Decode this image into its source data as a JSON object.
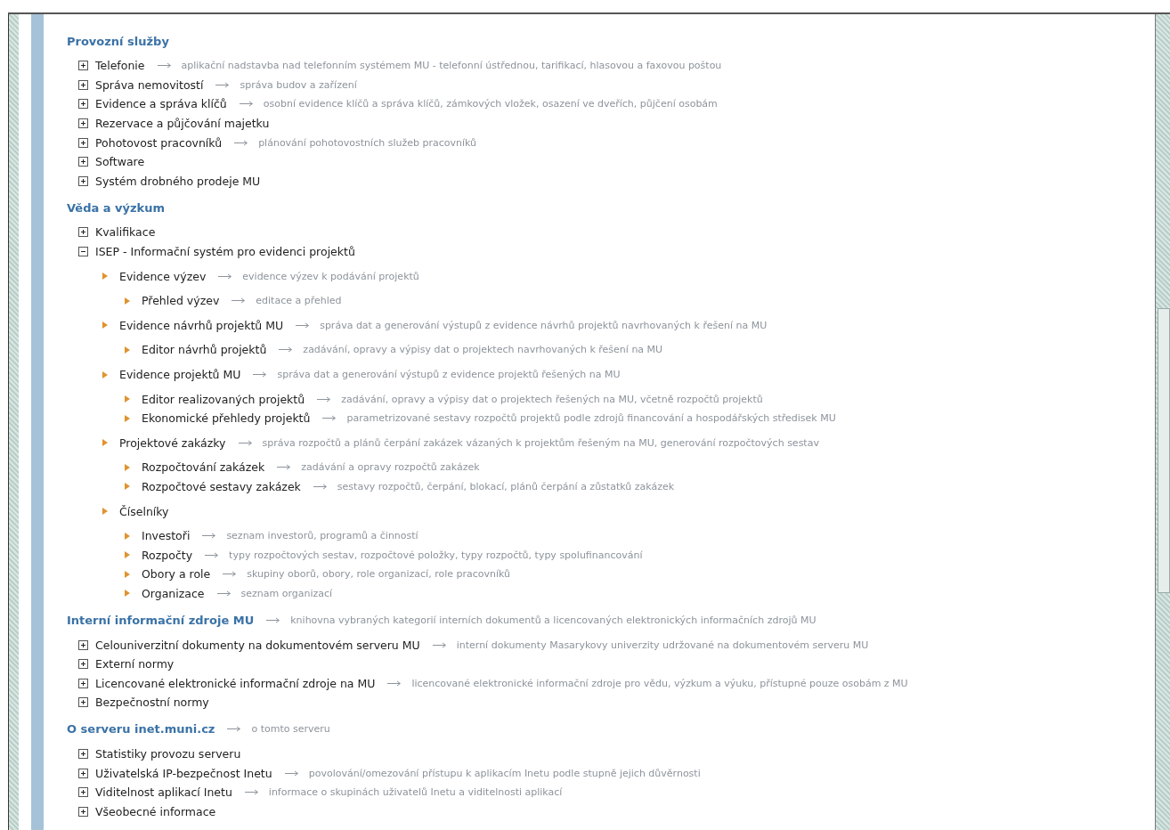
{
  "sections": [
    {
      "title": "Provozní služby",
      "items": [
        {
          "label": "Telefonie",
          "description": "aplikační nadstavba nad telefonním systémem MU - telefonní ústřednou, tarifikací, hlasovou a faxovou poštou",
          "expanded": false
        },
        {
          "label": "Správa nemovitostí",
          "description": "správa budov a zařízení",
          "expanded": false
        },
        {
          "label": "Evidence a správa klíčů",
          "description": "osobní evidence klíčů a správa klíčů, zámkových vložek, osazení ve dveřích, půjčení osobám",
          "expanded": false
        },
        {
          "label": "Rezervace a půjčování majetku",
          "expanded": false
        },
        {
          "label": "Pohotovost pracovníků",
          "description": "plánování pohotovostních služeb pracovníků",
          "expanded": false
        },
        {
          "label": "Software",
          "expanded": false
        },
        {
          "label": "Systém drobného prodeje MU",
          "expanded": false
        }
      ]
    },
    {
      "title": "Věda a výzkum",
      "items": [
        {
          "label": "Kvalifikace",
          "expanded": false
        },
        {
          "label": "ISEP - Informační systém pro evidenci projektů",
          "expanded": true,
          "children": [
            {
              "label": "Evidence výzev",
              "description": "evidence výzev k podávání projektů",
              "children": [
                {
                  "label": "Přehled výzev",
                  "description": "editace a přehled"
                }
              ]
            },
            {
              "label": "Evidence návrhů projektů MU",
              "description": "správa dat a generování výstupů z evidence návrhů projektů navrhovaných k řešení na MU",
              "children": [
                {
                  "label": "Editor návrhů projektů",
                  "description": "zadávání, opravy a výpisy dat o projektech navrhovaných k řešení na MU"
                }
              ]
            },
            {
              "label": "Evidence projektů MU",
              "description": "správa dat a generování výstupů z evidence projektů řešených na MU",
              "children": [
                {
                  "label": "Editor realizovaných projektů",
                  "description": "zadávání, opravy a výpisy dat o projektech řešených na MU, včetně rozpočtů projektů"
                },
                {
                  "label": "Ekonomické přehledy projektů",
                  "description": "parametrizované sestavy rozpočtů projektů podle zdrojů financování a hospodářských středisek MU"
                }
              ]
            },
            {
              "label": "Projektové zakázky",
              "description": "správa rozpočtů a plánů čerpání zakázek vázaných k projektům řešeným na MU, generování rozpočtových sestav",
              "children": [
                {
                  "label": "Rozpočtování zakázek",
                  "description": "zadávání a opravy rozpočtů zakázek"
                },
                {
                  "label": "Rozpočtové sestavy zakázek",
                  "description": "sestavy rozpočtů, čerpání, blokací, plánů čerpání a zůstatků zakázek"
                }
              ]
            },
            {
              "label": "Číselníky",
              "children": [
                {
                  "label": "Investoři",
                  "description": "seznam investorů, programů a činností"
                },
                {
                  "label": "Rozpočty",
                  "description": "typy rozpočtových sestav, rozpočtové položky, typy rozpočtů, typy spolufinancování"
                },
                {
                  "label": "Obory a role",
                  "description": "skupiny oborů, obory, role organizací, role pracovníků"
                },
                {
                  "label": "Organizace",
                  "description": "seznam organizací"
                }
              ]
            }
          ]
        }
      ]
    },
    {
      "title": "Interní informační zdroje MU",
      "description": "knihovna vybraných kategorií interních dokumentů a licencovaných elektronických informačních zdrojů MU",
      "items": [
        {
          "label": "Celouniverzitní dokumenty na dokumentovém serveru MU",
          "description": "interní dokumenty Masarykovy univerzity udržované na dokumentovém serveru MU",
          "expanded": false
        },
        {
          "label": "Externí normy",
          "expanded": false
        },
        {
          "label": "Licencované elektronické informační zdroje na MU",
          "description": "licencované elektronické informační zdroje pro vědu, výzkum a výuku, přístupné pouze osobám z MU",
          "expanded": false
        },
        {
          "label": "Bezpečnostní normy",
          "expanded": false
        }
      ]
    },
    {
      "title": "O serveru inet.muni.cz",
      "description": "o tomto serveru",
      "items": [
        {
          "label": "Statistiky provozu serveru",
          "expanded": false
        },
        {
          "label": "Uživatelská IP-bezpečnost Inetu",
          "description": "povolování/omezování přístupu k aplikacím Inetu podle stupně jejich důvěrnosti",
          "expanded": false
        },
        {
          "label": "Viditelnost aplikací Inetu",
          "description": "informace o skupinách uživatelů Inetu a viditelnosti aplikací",
          "expanded": false
        },
        {
          "label": "Všeobecné informace",
          "expanded": false
        }
      ]
    }
  ]
}
